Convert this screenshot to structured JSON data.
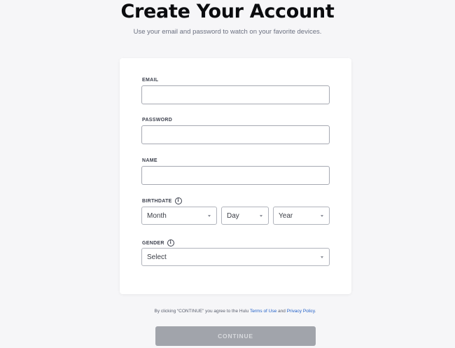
{
  "header": {
    "title": "Create Your Account",
    "subtitle": "Use your email and password to watch on your favorite devices."
  },
  "form": {
    "email_label": "EMAIL",
    "email_value": "",
    "password_label": "PASSWORD",
    "password_value": "",
    "name_label": "NAME",
    "name_value": "",
    "birthdate_label": "BIRTHDATE",
    "birthdate_month": "Month",
    "birthdate_day": "Day",
    "birthdate_year": "Year",
    "gender_label": "GENDER",
    "gender_value": "Select",
    "info_icon_glyph": "i"
  },
  "footer": {
    "terms_prefix": "By clicking “CONTINUE” you agree to the Hulu ",
    "terms_link": "Terms of Use",
    "terms_and": " and ",
    "privacy_link": "Privacy Policy",
    "terms_suffix": ".",
    "continue_label": "CONTINUE"
  },
  "colors": {
    "background": "#f6f6f8",
    "card": "#ffffff",
    "link": "#2260c8",
    "continue_disabled": "#a1a4ab"
  }
}
